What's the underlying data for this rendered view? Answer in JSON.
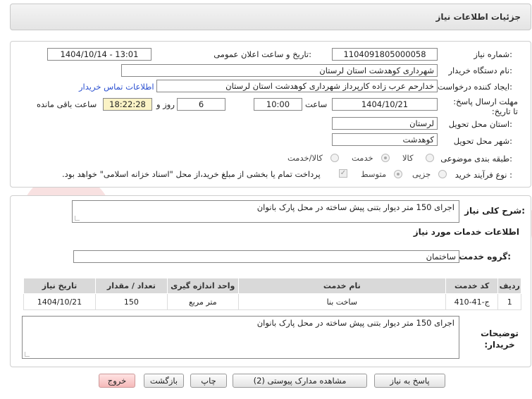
{
  "page": {
    "title": "جزئیات اطلاعات نیاز"
  },
  "info": {
    "need_number_label": "شماره نیاز:",
    "need_number": "1104091805000058",
    "announce_label": "تاریخ و ساعت اعلان عمومی:",
    "announce_value": "1404/10/14 - 13:01",
    "buyer_label": "نام دستگاه خریدار:",
    "buyer_value": "شهرداری کوهدشت استان لرستان",
    "creator_label": "ایجاد کننده درخواست:",
    "creator_value": "خدارحم عرب زاده کارپرداز شهرداری کوهدشت استان لرستان",
    "contact_link": "اطلاعات تماس خریدار",
    "deadline_label": "مهلت ارسال پاسخ: تا تاریخ:",
    "deadline_date": "1404/10/21",
    "hour_label": "ساعت",
    "deadline_time": "10:00",
    "days_value": "6",
    "days_label": "روز و",
    "remaining_time": "18:22:28",
    "remaining_label": "ساعت باقی مانده",
    "province_label": "استان محل تحویل:",
    "province_value": "لرستان",
    "city_label": "شهر محل تحویل:",
    "city_value": "کوهدشت",
    "category_label": "طبقه بندی موضوعی:",
    "category_options": [
      "کالا",
      "خدمت",
      "کالا/خدمت"
    ],
    "process_label": "نوع فرآیند خرید :",
    "process_options": [
      "جزیی",
      "متوسط"
    ],
    "payment_note": "پرداخت تمام یا بخشی از مبلغ خرید،از محل \"اسناد خزانه اسلامی\" خواهد بود."
  },
  "summary": {
    "label": "شرح کلی نیاز:",
    "value": "اجرای 150 متر دیوار بتنی پیش ساخته در محل پارک بانوان"
  },
  "services": {
    "section_title": "اطلاعات خدمات مورد نیاز",
    "group_label": "گروه خدمت:",
    "group_value": "ساختمان",
    "columns": [
      "ردیف",
      "کد خدمت",
      "نام خدمت",
      "واحد اندازه گیری",
      "تعداد / مقدار",
      "تاریخ نیاز"
    ],
    "rows": [
      {
        "index": "1",
        "code": "ج-41-410",
        "name": "ساخت بنا",
        "unit": "متر مربع",
        "qty": "150",
        "date": "1404/10/21"
      }
    ]
  },
  "buyer_notes": {
    "label": "توضیحات خریدار:",
    "value": "اجرای 150 متر دیوار بتنی پیش ساخته در محل پارک بانوان"
  },
  "buttons": {
    "reply": "پاسخ به نیاز",
    "attachments": "مشاهده مدارک پیوستی (2)",
    "print": "چاپ",
    "back": "بازگشت",
    "exit": "خروج"
  },
  "watermark": {
    "text": "AriaTender.net"
  },
  "colors": {
    "link": "#2a4fd0",
    "remaining_bg": "#fbf3c6",
    "exit_bg": "#f5b9b9"
  }
}
